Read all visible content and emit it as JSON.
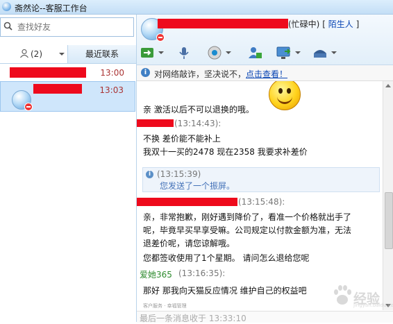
{
  "window": {
    "title": "斋然论--客服工作台"
  },
  "left": {
    "search_placeholder": "查找好友",
    "tab_contacts_count": "(2)",
    "tab_recent": "最近联系",
    "contacts": [
      {
        "time": "13:00"
      },
      {
        "time": "13:03"
      }
    ]
  },
  "header": {
    "status_suffix": "(忙碌中)",
    "bracket_open": "[",
    "stranger_link": "陌生人",
    "bracket_close": "]"
  },
  "toolbar": {
    "icons": [
      "transfer-icon",
      "voice-icon",
      "video-icon",
      "contact-card-icon",
      "remote-icon",
      "more-icon"
    ]
  },
  "notice": {
    "text": "对网络敲诈，坚决说不，",
    "link": "点击查看！"
  },
  "messages": [
    {
      "text": "亲 激活以后不可以退换的哦。"
    },
    {
      "time": "(13:14:43):",
      "lines": [
        "不换 差价能不能补上",
        "我双十一买的2478  现在2358  我要求补差价"
      ]
    },
    {
      "time": "(13:15:39)",
      "system_text": "您发送了一个振屏。"
    },
    {
      "time": "(13:15:48):",
      "lines": [
        "亲，非常抱歉，刚好遇到降价了，看准一个价格就出手了",
        "呢，毕竟早买早享受嘛。公司规定以付款金额为准，无法",
        "退差价呢，请您谅解哦。",
        "您都签收使用了1个星期。  请问怎么退给您呢"
      ]
    },
    {
      "sender": "爱她365",
      "time": "(13:16:35):",
      "lines": [
        "那好  那我向天猫反应情况  维护自己的权益吧"
      ],
      "signature": "客户服务 · 幸福管理"
    }
  ],
  "status_bar": {
    "text": "最后一条消息收于 13:33:10"
  },
  "watermark": {
    "text": "经验",
    "sub": "jingyan.baidu.com"
  }
}
